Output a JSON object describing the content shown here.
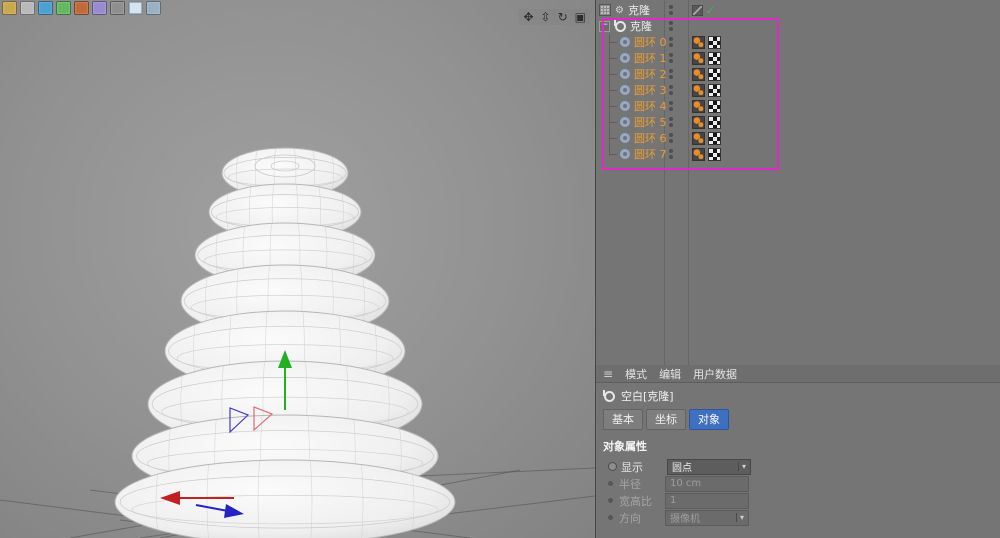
{
  "toolbar": {
    "icons": [
      {
        "name": "toolbar-icon",
        "color": "#c9a84e"
      },
      {
        "name": "toolbar-icon",
        "color": "#b9b9b9"
      },
      {
        "name": "toolbar-icon",
        "color": "#4aa0d0"
      },
      {
        "name": "toolbar-icon",
        "color": "#64b864"
      },
      {
        "name": "toolbar-icon",
        "color": "#c06a3a"
      },
      {
        "name": "toolbar-icon",
        "color": "#9a8ad0"
      },
      {
        "name": "toolbar-icon",
        "color": "#8f8f8f"
      },
      {
        "name": "toolbar-icon",
        "color": "#d7e4ef",
        "pressed": true
      },
      {
        "name": "toolbar-icon",
        "color": "#9ab0c4"
      }
    ]
  },
  "viewport": {
    "nav_icons": [
      {
        "name": "pan-view-icon",
        "glyph": "✥"
      },
      {
        "name": "dolly-view-icon",
        "glyph": "⇳"
      },
      {
        "name": "rotate-view-icon",
        "glyph": "↻"
      },
      {
        "name": "maximize-view-icon",
        "glyph": "▣"
      }
    ]
  },
  "object_manager": {
    "cloner_row": {
      "label": "克隆",
      "check_glyph": "✓"
    },
    "root_row": {
      "label": "克隆"
    },
    "children": [
      {
        "label": "圆环 0"
      },
      {
        "label": "圆环 1"
      },
      {
        "label": "圆环 2"
      },
      {
        "label": "圆环 3"
      },
      {
        "label": "圆环 4"
      },
      {
        "label": "圆环 5"
      },
      {
        "label": "圆环 6"
      },
      {
        "label": "圆环 7"
      }
    ]
  },
  "attribute_manager": {
    "menu_items": [
      "模式",
      "编辑",
      "用户数据"
    ],
    "object_label": "空白[克隆]",
    "tabs": [
      "基本",
      "坐标",
      "对象"
    ],
    "active_tab": "对象",
    "section_title": "对象属性",
    "properties": [
      {
        "label": "显示",
        "value": "圆点",
        "control": "dropdown",
        "enabled": true
      },
      {
        "label": "半径",
        "value": "10 cm",
        "control": "field",
        "enabled": false
      },
      {
        "label": "宽高比",
        "value": "1",
        "control": "field",
        "enabled": false
      },
      {
        "label": "方向",
        "value": "摄像机",
        "control": "dropdown",
        "enabled": false
      }
    ]
  },
  "colors": {
    "selection_rect": "#e228c8",
    "active_tab": "#3e6fc0",
    "child_label": "#ef9c31",
    "check": "#46b846"
  }
}
